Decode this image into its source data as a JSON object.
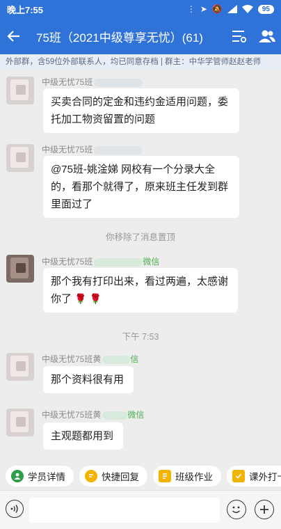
{
  "status_bar": {
    "time": "晚上7:55",
    "battery": "95"
  },
  "header": {
    "title": "75班（2021中级尊享无忧）(61)"
  },
  "group_info": {
    "text": "外部群，含59位外部联系人，均已同意存档 | 群主：中华学管师赵赵老师"
  },
  "messages": [
    {
      "sender": "中级无忧75班",
      "sender_tail": "",
      "text": "买卖合同的定金和违约金适用问题，委托加工物资留置的问题"
    },
    {
      "sender": "中级无忧75班",
      "sender_tail": "",
      "text": "@75班-姚淦娣 网校有一个分录大全的，看那个就得了，原来班主任发到群里面过了"
    },
    {
      "system": "你移除了消息置顶"
    },
    {
      "sender": "中级无忧75班",
      "sender_tail": "微信",
      "text": "那个我有打印出来，看过两遍，太感谢你了"
    },
    {
      "system": "下午 7:53"
    },
    {
      "sender": "中级无忧75班黄",
      "sender_tail": "信",
      "text": "那个资料很有用"
    },
    {
      "sender": "中级无忧75班黄",
      "sender_tail": "微信",
      "text": "主观题都用到"
    }
  ],
  "quick_actions": [
    {
      "label": "学员详情",
      "color": "#2e9e48"
    },
    {
      "label": "快捷回复",
      "color": "#f2b400"
    },
    {
      "label": "班级作业",
      "color": "#f2b400"
    },
    {
      "label": "课外打卡",
      "color": "#f2b400"
    }
  ]
}
